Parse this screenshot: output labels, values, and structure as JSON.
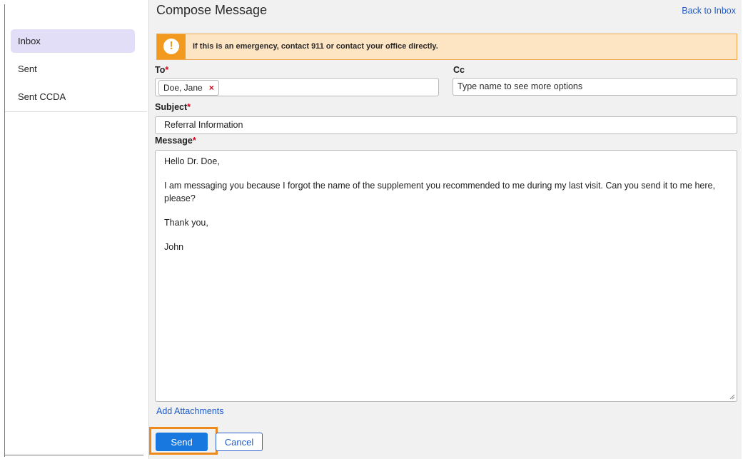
{
  "sidebar": {
    "items": [
      {
        "label": "Inbox",
        "active": true
      },
      {
        "label": "Sent",
        "active": false
      },
      {
        "label": "Sent CCDA",
        "active": false
      }
    ]
  },
  "header": {
    "title": "Compose Message",
    "back_link": "Back to Inbox"
  },
  "alert": {
    "icon": "exclamation-icon",
    "text": "If this is an emergency, contact 911 or contact your office directly."
  },
  "form": {
    "to": {
      "label": "To",
      "required_mark": "*",
      "recipients": [
        "Doe, Jane"
      ],
      "remove_glyph": "×"
    },
    "cc": {
      "label": "Cc",
      "placeholder": "Type name to see more options"
    },
    "subject": {
      "label": "Subject",
      "required_mark": "*",
      "value": "Referral Information"
    },
    "message": {
      "label": "Message",
      "required_mark": "*",
      "paragraphs": [
        "Hello Dr. Doe,",
        "I am messaging you because I forgot the name of the supplement you recommended to me during my last visit. Can you send it to me here, please?",
        "Thank you,",
        "John"
      ]
    },
    "add_attachments": "Add Attachments",
    "send_label": "Send",
    "cancel_label": "Cancel"
  },
  "colors": {
    "accent": "#1878e0",
    "link": "#1f5bc6",
    "alert_orange": "#f29a1f",
    "alert_bg": "#fde4c3",
    "highlight": "#ee8a1b",
    "required": "#d0021b"
  }
}
